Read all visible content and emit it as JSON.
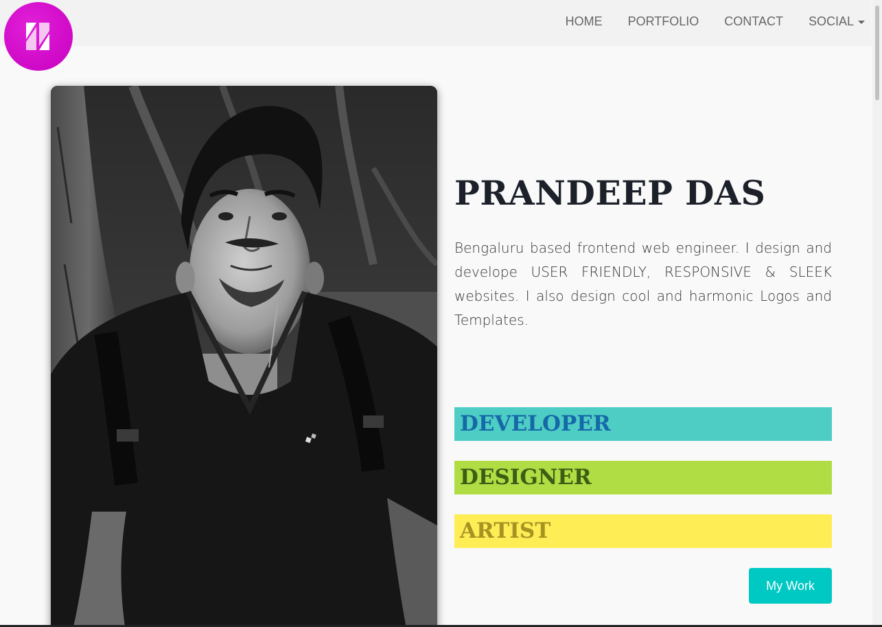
{
  "nav": {
    "items": [
      {
        "label": "HOME"
      },
      {
        "label": "PORTFOLIO"
      },
      {
        "label": "CONTACT"
      },
      {
        "label": "SOCIAL",
        "has_dropdown": true
      }
    ]
  },
  "logo": {
    "icon": "brand-logo-icon",
    "color": "#d60fd0"
  },
  "profile": {
    "photo": "portrait-photo",
    "name": "PRANDEEP DAS",
    "bio": "Bengaluru based frontend web engineer. I design and develope USER FRIENDLY, RESPONSIVE & SLEEK websites. I also design cool and harmonic Logos and Templates."
  },
  "roles": [
    {
      "label": "DEVELOPER",
      "bg": "#4ecdc4",
      "color": "#1669a8"
    },
    {
      "label": "DESIGNER",
      "bg": "#b0dc44",
      "color": "#3b5e14"
    },
    {
      "label": "ARTIST",
      "bg": "#feed55",
      "color": "#a69322"
    }
  ],
  "cta": {
    "label": "My Work",
    "color": "#00c8c3"
  }
}
